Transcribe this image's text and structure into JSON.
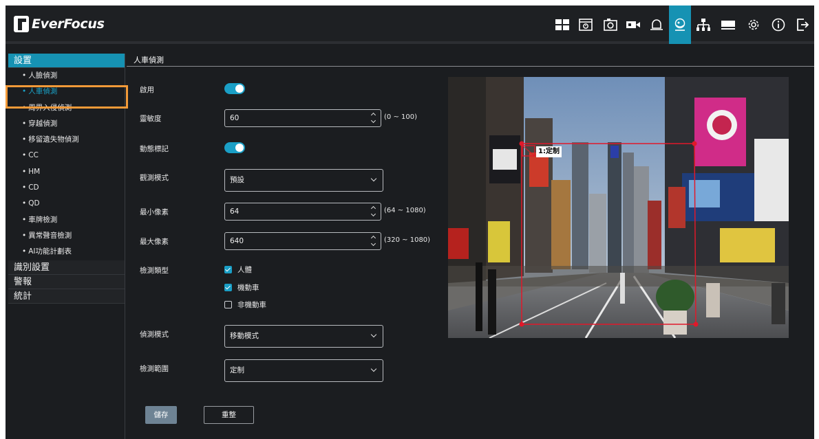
{
  "brand": {
    "logo_text": "EverFocus"
  },
  "toolbar": {
    "icons": [
      "layout-icon",
      "playback-icon",
      "snapshot-icon",
      "camera-icon",
      "alarm-bell-icon",
      "ai-detection-icon",
      "network-icon",
      "storage-icon",
      "settings-icon",
      "info-icon",
      "logout-icon"
    ],
    "active_icon": "ai-detection-icon",
    "accent_color": "#1692b3"
  },
  "sidebar": {
    "groups": [
      {
        "label": "設置",
        "items": [
          "人臉偵測",
          "人車偵測",
          "周界入侵偵測",
          "穿越偵測",
          "移留遺失物偵測",
          "CC",
          "HM",
          "CD",
          "QD",
          "車牌檢測",
          "異常聲音檢測",
          "AI功能計劃表"
        ],
        "selected_item": "人車偵測"
      },
      {
        "label": "識別設置"
      },
      {
        "label": "警報"
      },
      {
        "label": "統計"
      }
    ]
  },
  "page": {
    "title": "人車偵測"
  },
  "form": {
    "enable": {
      "label": "啟用",
      "on": true
    },
    "sensitivity": {
      "label": "靈敏度",
      "value": "60",
      "range": "(0 ~ 100)"
    },
    "motion_mark": {
      "label": "動態標記",
      "on": true
    },
    "sensor_mode": {
      "label": "觀測模式",
      "value": "預設"
    },
    "min_pixels": {
      "label": "最小像素",
      "value": "64",
      "range": "(64 ~ 1080)"
    },
    "max_pixels": {
      "label": "最大像素",
      "value": "640",
      "range": "(320 ~ 1080)"
    },
    "detect_type": {
      "label": "檢測類型",
      "options": [
        {
          "label": "人體",
          "checked": true
        },
        {
          "label": "機動車",
          "checked": true
        },
        {
          "label": "非機動車",
          "checked": false
        }
      ]
    },
    "detect_mode": {
      "label": "偵測模式",
      "value": "移動模式"
    },
    "detect_range": {
      "label": "檢測範圍",
      "value": "定制"
    }
  },
  "buttons": {
    "save": "儲存",
    "reset": "重整"
  },
  "camera": {
    "roi_label": "1:定制",
    "roi_color": "#e0192a"
  }
}
